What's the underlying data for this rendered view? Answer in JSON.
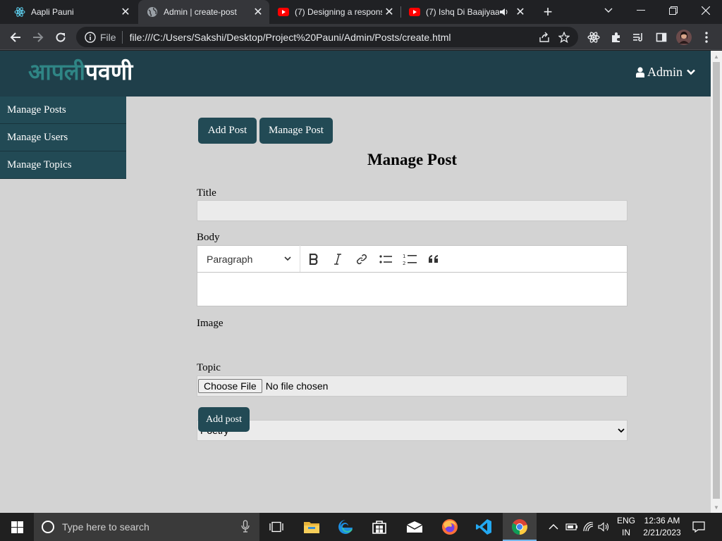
{
  "browser": {
    "tabs": [
      {
        "title": "Aapli Pauni",
        "active": false
      },
      {
        "title": "Admin | create-post",
        "active": true
      },
      {
        "title": "(7) Designing a respons",
        "active": false
      },
      {
        "title": "(7) Ishq Di Baajiyaa",
        "active": false
      }
    ],
    "address": {
      "scheme_label": "File",
      "url": "file:///C:/Users/Sakshi/Desktop/Project%20Pauni/Admin/Posts/create.html"
    }
  },
  "site": {
    "logo_part1": "आपली",
    "logo_part2": "पवणी",
    "user_menu_label": "Admin"
  },
  "sidebar": {
    "items": [
      {
        "label": "Manage Posts"
      },
      {
        "label": "Manage Users"
      },
      {
        "label": "Manage Topics"
      }
    ]
  },
  "content": {
    "add_post_button": "Add Post",
    "manage_post_button": "Manage Post",
    "heading": "Manage Post",
    "title_label": "Title",
    "title_value": "",
    "body_label": "Body",
    "editor": {
      "block_format": "Paragraph",
      "body_value": ""
    },
    "image_label": "Image",
    "file_button": "Choose File",
    "file_status": "No file chosen",
    "topic_label": "Topic",
    "topic_selected": "Poetry",
    "submit_button": "Add post"
  },
  "taskbar": {
    "search_placeholder": "Type here to search",
    "language_line1": "ENG",
    "language_line2": "IN",
    "time": "12:36 AM",
    "date": "2/21/2023"
  },
  "colors": {
    "header_bg": "#1f3f4a",
    "sidebar_item_bg": "#224a55",
    "button_bg": "#224a55",
    "logo_accent": "#2f8585",
    "page_bg": "#d3d3d3"
  }
}
